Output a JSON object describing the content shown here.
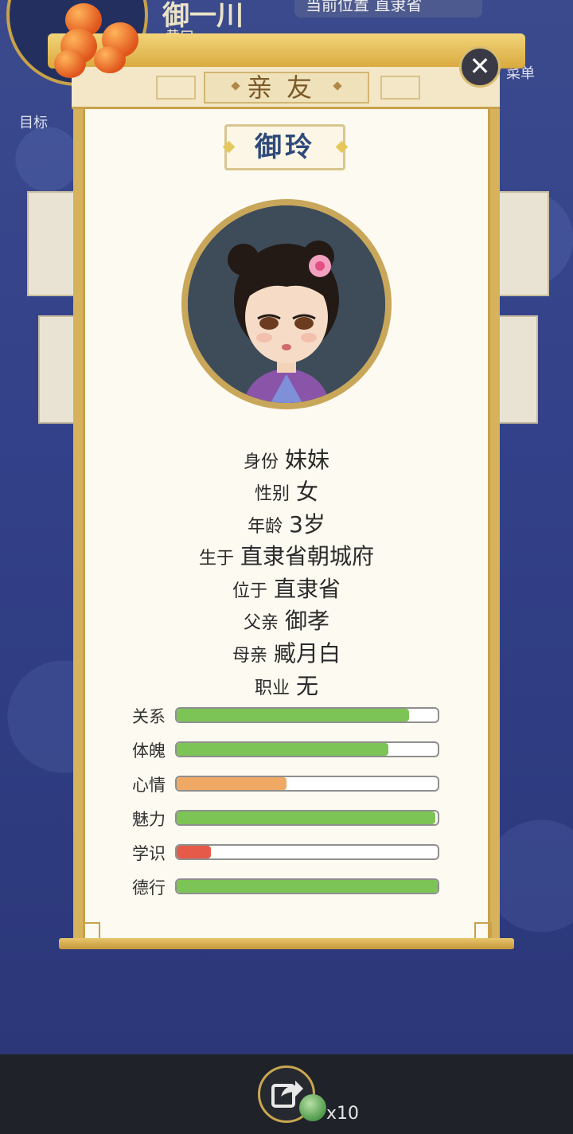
{
  "background": {
    "player_name": "御一川",
    "player_sub": "黄口",
    "location_label": "当前位置 直隶省",
    "goal_label": "目标",
    "menu_label": "菜单"
  },
  "dialog": {
    "title": "亲友",
    "close_symbol": "✕",
    "name": "御玲",
    "info": [
      {
        "label": "身份",
        "value": "妹妹"
      },
      {
        "label": "性别",
        "value": "女"
      },
      {
        "label": "年龄",
        "value": "3岁"
      },
      {
        "label": "生于",
        "value": "直隶省朝城府"
      },
      {
        "label": "位于",
        "value": "直隶省"
      },
      {
        "label": "父亲",
        "value": "御孝"
      },
      {
        "label": "母亲",
        "value": "臧月白"
      },
      {
        "label": "职业",
        "value": "无"
      }
    ],
    "stats": [
      {
        "label": "关系",
        "value": 0.89,
        "color": "#7cc455"
      },
      {
        "label": "体魄",
        "value": 0.81,
        "color": "#7cc455"
      },
      {
        "label": "心情",
        "value": 0.42,
        "color": "#f0a865"
      },
      {
        "label": "魅力",
        "value": 0.99,
        "color": "#7cc455"
      },
      {
        "label": "学识",
        "value": 0.13,
        "color": "#e55a48"
      },
      {
        "label": "德行",
        "value": 1.0,
        "color": "#7cc455"
      }
    ]
  },
  "bottom": {
    "share_icon": "share-icon",
    "coin_icon": "jade-coin-icon",
    "count": "x10"
  }
}
